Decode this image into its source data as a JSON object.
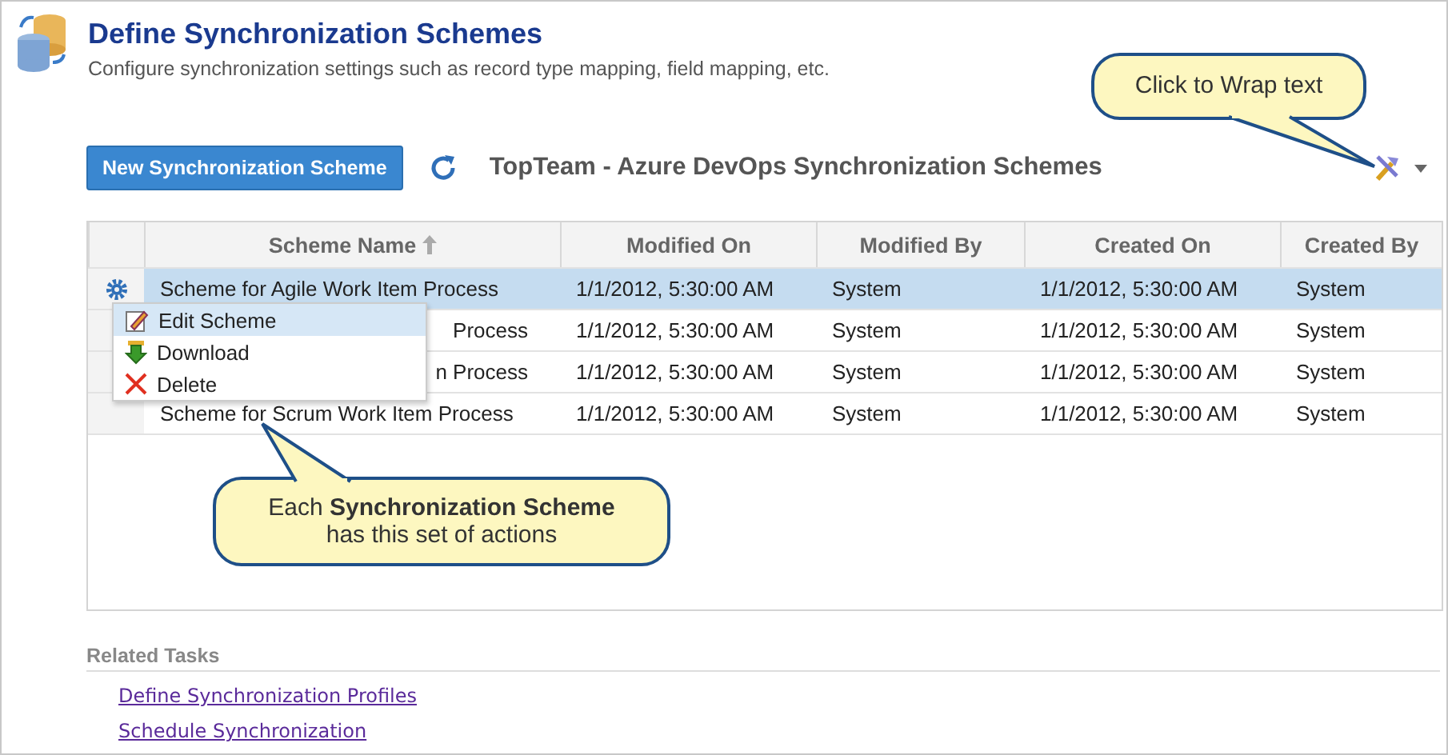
{
  "header": {
    "title": "Define Synchronization Schemes",
    "subtitle": "Configure synchronization settings such as record type mapping, field mapping, etc."
  },
  "toolbar": {
    "new_button": "New Synchronization Scheme",
    "grid_title": "TopTeam - Azure DevOps Synchronization Schemes"
  },
  "table": {
    "columns": [
      {
        "label": "Scheme Name",
        "sorted": true
      },
      {
        "label": "Modified On",
        "sorted": false
      },
      {
        "label": "Modified By",
        "sorted": false
      },
      {
        "label": "Created On",
        "sorted": false
      },
      {
        "label": "Created By",
        "sorted": false
      }
    ],
    "rows": [
      {
        "selected": true,
        "cut": false,
        "cells": [
          "Scheme for Agile Work Item Process",
          "1/1/2012, 5:30:00 AM",
          "System",
          "1/1/2012, 5:30:00 AM",
          "System"
        ]
      },
      {
        "selected": false,
        "cut": true,
        "cells": [
          "Process",
          "1/1/2012, 5:30:00 AM",
          "System",
          "1/1/2012, 5:30:00 AM",
          "System"
        ]
      },
      {
        "selected": false,
        "cut": true,
        "cells": [
          "n Process",
          "1/1/2012, 5:30:00 AM",
          "System",
          "1/1/2012, 5:30:00 AM",
          "System"
        ]
      },
      {
        "selected": false,
        "cut": false,
        "cells": [
          "Scheme for Scrum Work Item Process",
          "1/1/2012, 5:30:00 AM",
          "System",
          "1/1/2012, 5:30:00 AM",
          "System"
        ]
      }
    ]
  },
  "context_menu": [
    {
      "kind": "edit",
      "label": "Edit Scheme",
      "selected": true
    },
    {
      "kind": "download",
      "label": "Download",
      "selected": false
    },
    {
      "kind": "delete",
      "label": "Delete",
      "selected": false
    }
  ],
  "callouts": [
    {
      "kind": "top",
      "text": "Click to Wrap text"
    },
    {
      "kind": "bottom",
      "text": "Each **Synchronization Scheme**\nhas this set of actions"
    }
  ],
  "related_tasks": {
    "heading": "Related Tasks",
    "links": [
      "Define Synchronization Profiles",
      "Schedule Synchronization"
    ]
  }
}
